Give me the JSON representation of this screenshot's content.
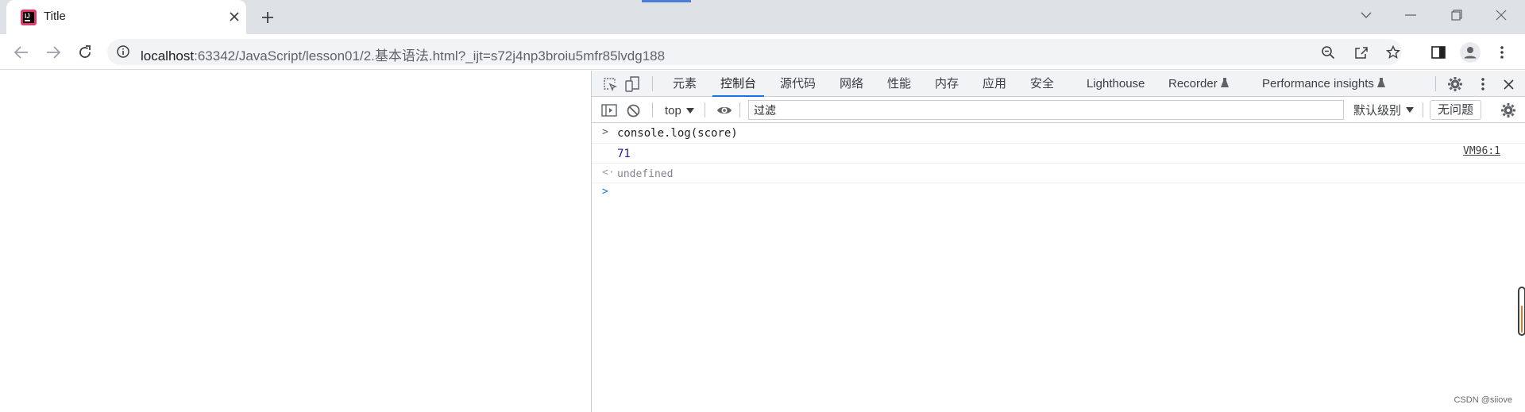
{
  "tab": {
    "title": "Title"
  },
  "address": {
    "host": "localhost",
    "rest": ":63342/JavaScript/lesson01/2.基本语法.html?_ijt=s72j4np3broiu5mfr85lvdg188"
  },
  "devtools": {
    "tabs": [
      "元素",
      "控制台",
      "源代码",
      "网络",
      "性能",
      "内存",
      "应用",
      "安全",
      "Lighthouse",
      "Recorder",
      "Performance insights"
    ],
    "active_tab": "控制台",
    "context": "top",
    "filter_placeholder": "过滤",
    "levels": "默认级别",
    "issues": "无问题"
  },
  "console": {
    "input": "console.log(score)",
    "output": "71",
    "source": "VM96:1",
    "return": "undefined"
  },
  "watermark": "CSDN @siiove",
  "colors": {
    "accent": "#1a73e8",
    "number": "#1a1aa6",
    "scroll_fill": "#e9761f"
  }
}
